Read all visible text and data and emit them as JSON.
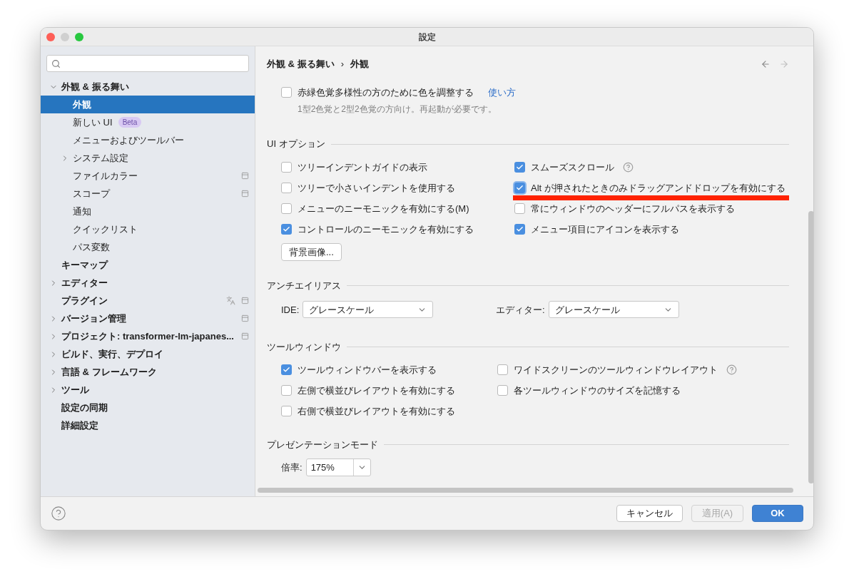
{
  "window": {
    "title": "設定"
  },
  "sidebar": {
    "items": [
      {
        "label": "外観 & 振る舞い",
        "kind": "folder",
        "expanded": true,
        "selected": false,
        "children": [
          {
            "label": "外観",
            "kind": "leaf",
            "selected": true
          },
          {
            "label": "新しい UI",
            "kind": "leaf",
            "selected": false,
            "badge": "Beta"
          },
          {
            "label": "メニューおよびツールバー",
            "kind": "leaf",
            "selected": false
          },
          {
            "label": "システム設定",
            "kind": "folder",
            "expanded": false,
            "selected": false
          },
          {
            "label": "ファイルカラー",
            "kind": "leaf",
            "selected": false,
            "project_icon": true
          },
          {
            "label": "スコープ",
            "kind": "leaf",
            "selected": false,
            "project_icon": true
          },
          {
            "label": "通知",
            "kind": "leaf",
            "selected": false
          },
          {
            "label": "クイックリスト",
            "kind": "leaf",
            "selected": false
          },
          {
            "label": "パス変数",
            "kind": "leaf",
            "selected": false
          }
        ]
      },
      {
        "label": "キーマップ",
        "kind": "leaf",
        "selected": false
      },
      {
        "label": "エディター",
        "kind": "folder",
        "expanded": false,
        "selected": false
      },
      {
        "label": "プラグイン",
        "kind": "leaf",
        "selected": false,
        "project_icon": true,
        "translate_icon": true
      },
      {
        "label": "バージョン管理",
        "kind": "folder",
        "expanded": false,
        "selected": false,
        "project_icon": true
      },
      {
        "label": "プロジェクト: transformer-lm-japanes...",
        "kind": "folder",
        "expanded": false,
        "selected": false,
        "project_icon": true
      },
      {
        "label": "ビルド、実行、デプロイ",
        "kind": "folder",
        "expanded": false,
        "selected": false
      },
      {
        "label": "言語 & フレームワーク",
        "kind": "folder",
        "expanded": false,
        "selected": false
      },
      {
        "label": "ツール",
        "kind": "folder",
        "expanded": false,
        "selected": false
      },
      {
        "label": "設定の同期",
        "kind": "leaf",
        "selected": false
      },
      {
        "label": "詳細設定",
        "kind": "leaf",
        "selected": false
      }
    ]
  },
  "breadcrumb": {
    "parts": [
      "外観 & 振る舞い",
      "外観"
    ],
    "separator": "›"
  },
  "color_option": {
    "label": "赤緑色覚多様性の方のために色を調整する",
    "checked": false,
    "link": "使い方",
    "hint": "1型2色覚と2型2色覚の方向け。再起動が必要です。"
  },
  "sections": [
    {
      "title": "UI オプション",
      "kind": "checkboxes",
      "columns": [
        [
          {
            "label": "ツリーインデントガイドの表示",
            "checked": false,
            "help": false,
            "underlined": false
          },
          {
            "label": "ツリーで小さいインデントを使用する",
            "checked": false,
            "help": false,
            "underlined": false
          },
          {
            "label": "メニューのニーモニックを有効にする(M)",
            "checked": false,
            "help": false,
            "underlined": false
          },
          {
            "label": "コントロールのニーモニックを有効にする",
            "checked": true,
            "help": false,
            "underlined": false
          }
        ],
        [
          {
            "label": "スムーズスクロール",
            "checked": true,
            "help": true,
            "underlined": false
          },
          {
            "label": "Alt が押されたときのみドラッグアンドドロップを有効にする",
            "checked": true,
            "help": false,
            "underlined": true
          },
          {
            "label": "常にウィンドウのヘッダーにフルパスを表示する",
            "checked": false,
            "help": false,
            "underlined": false
          },
          {
            "label": "メニュー項目にアイコンを表示する",
            "checked": true,
            "help": false,
            "underlined": false
          }
        ]
      ],
      "button": "背景画像..."
    },
    {
      "title": "アンチエイリアス",
      "kind": "dropdowns",
      "fields": [
        {
          "label": "IDE:",
          "value": "グレースケール"
        },
        {
          "label": "エディター:",
          "value": "グレースケール"
        }
      ]
    },
    {
      "title": "ツールウィンドウ",
      "kind": "checkboxes",
      "columns": [
        [
          {
            "label": "ツールウィンドウバーを表示する",
            "checked": true,
            "help": false,
            "underlined": false
          },
          {
            "label": "左側で横並びレイアウトを有効にする",
            "checked": false,
            "help": false,
            "underlined": false
          },
          {
            "label": "右側で横並びレイアウトを有効にする",
            "checked": false,
            "help": false,
            "underlined": false
          }
        ],
        [
          {
            "label": "ワイドスクリーンのツールウィンドウレイアウト",
            "checked": false,
            "help": true,
            "underlined": false
          },
          {
            "label": "各ツールウィンドウのサイズを記憶する",
            "checked": false,
            "help": false,
            "underlined": false
          }
        ]
      ]
    },
    {
      "title": "プレゼンテーションモード",
      "kind": "combo",
      "label": "倍率:",
      "value": "175%"
    }
  ],
  "footer": {
    "buttons": [
      {
        "label": "キャンセル",
        "kind": "secondary",
        "disabled": false
      },
      {
        "label": "適用(A)",
        "kind": "secondary",
        "disabled": true
      },
      {
        "label": "OK",
        "kind": "primary",
        "disabled": false
      }
    ]
  }
}
